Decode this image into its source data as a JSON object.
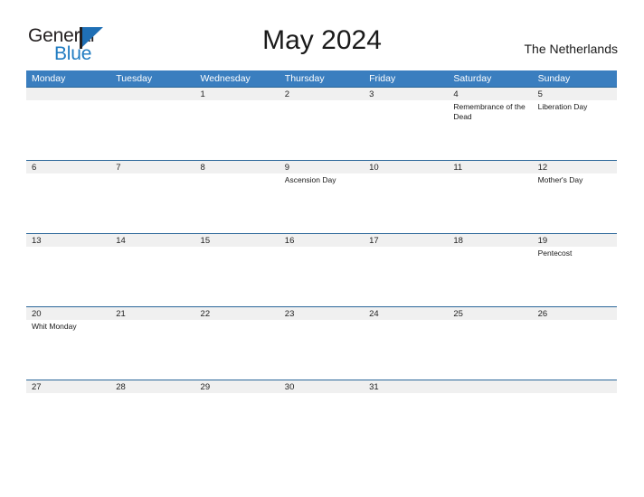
{
  "brand": {
    "name_part1": "General",
    "name_part2": "Blue",
    "logo_icon": "flag-triangle-icon",
    "accent_color": "#1f7bc1"
  },
  "header": {
    "title": "May 2024",
    "region": "The Netherlands"
  },
  "theme": {
    "header_blue": "#3a7ebf",
    "separator_blue": "#2a6699",
    "date_band_gray": "#f0f0f0",
    "text_dark": "#1a1a1a"
  },
  "calendar": {
    "month": "May",
    "year": "2024",
    "weekday_headers": [
      "Monday",
      "Tuesday",
      "Wednesday",
      "Thursday",
      "Friday",
      "Saturday",
      "Sunday"
    ],
    "weeks": [
      {
        "days": [
          {
            "num": "",
            "events": []
          },
          {
            "num": "",
            "events": []
          },
          {
            "num": "1",
            "events": []
          },
          {
            "num": "2",
            "events": []
          },
          {
            "num": "3",
            "events": []
          },
          {
            "num": "4",
            "events": [
              "Remembrance of the Dead"
            ]
          },
          {
            "num": "5",
            "events": [
              "Liberation Day"
            ]
          }
        ]
      },
      {
        "days": [
          {
            "num": "6",
            "events": []
          },
          {
            "num": "7",
            "events": []
          },
          {
            "num": "8",
            "events": []
          },
          {
            "num": "9",
            "events": [
              "Ascension Day"
            ]
          },
          {
            "num": "10",
            "events": []
          },
          {
            "num": "11",
            "events": []
          },
          {
            "num": "12",
            "events": [
              "Mother's Day"
            ]
          }
        ]
      },
      {
        "days": [
          {
            "num": "13",
            "events": []
          },
          {
            "num": "14",
            "events": []
          },
          {
            "num": "15",
            "events": []
          },
          {
            "num": "16",
            "events": []
          },
          {
            "num": "17",
            "events": []
          },
          {
            "num": "18",
            "events": []
          },
          {
            "num": "19",
            "events": [
              "Pentecost"
            ]
          }
        ]
      },
      {
        "days": [
          {
            "num": "20",
            "events": [
              "Whit Monday"
            ]
          },
          {
            "num": "21",
            "events": []
          },
          {
            "num": "22",
            "events": []
          },
          {
            "num": "23",
            "events": []
          },
          {
            "num": "24",
            "events": []
          },
          {
            "num": "25",
            "events": []
          },
          {
            "num": "26",
            "events": []
          }
        ]
      },
      {
        "days": [
          {
            "num": "27",
            "events": []
          },
          {
            "num": "28",
            "events": []
          },
          {
            "num": "29",
            "events": []
          },
          {
            "num": "30",
            "events": []
          },
          {
            "num": "31",
            "events": []
          },
          {
            "num": "",
            "events": []
          },
          {
            "num": "",
            "events": []
          }
        ]
      }
    ]
  }
}
